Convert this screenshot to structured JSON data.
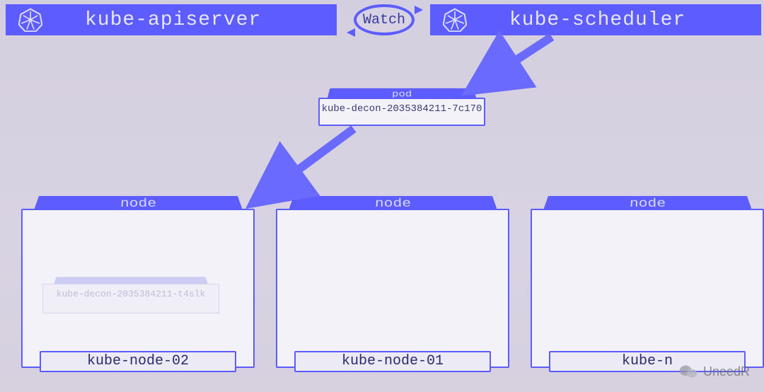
{
  "top": {
    "apiserver_label": "kube-apiserver",
    "scheduler_label": "kube-scheduler",
    "watch_label": "Watch"
  },
  "pod": {
    "top_label": "pod",
    "name": "kube-decon-2035384211-7c170"
  },
  "ghost_pod": {
    "name": "kube-decon-2035384211-t4slk"
  },
  "nodes": [
    {
      "top_label": "node",
      "name": "kube-node-02"
    },
    {
      "top_label": "node",
      "name": "kube-node-01"
    },
    {
      "top_label": "node",
      "name": "kube-n"
    }
  ],
  "watermark": {
    "text": "UneedR"
  },
  "colors": {
    "accent": "#5c5cff"
  }
}
